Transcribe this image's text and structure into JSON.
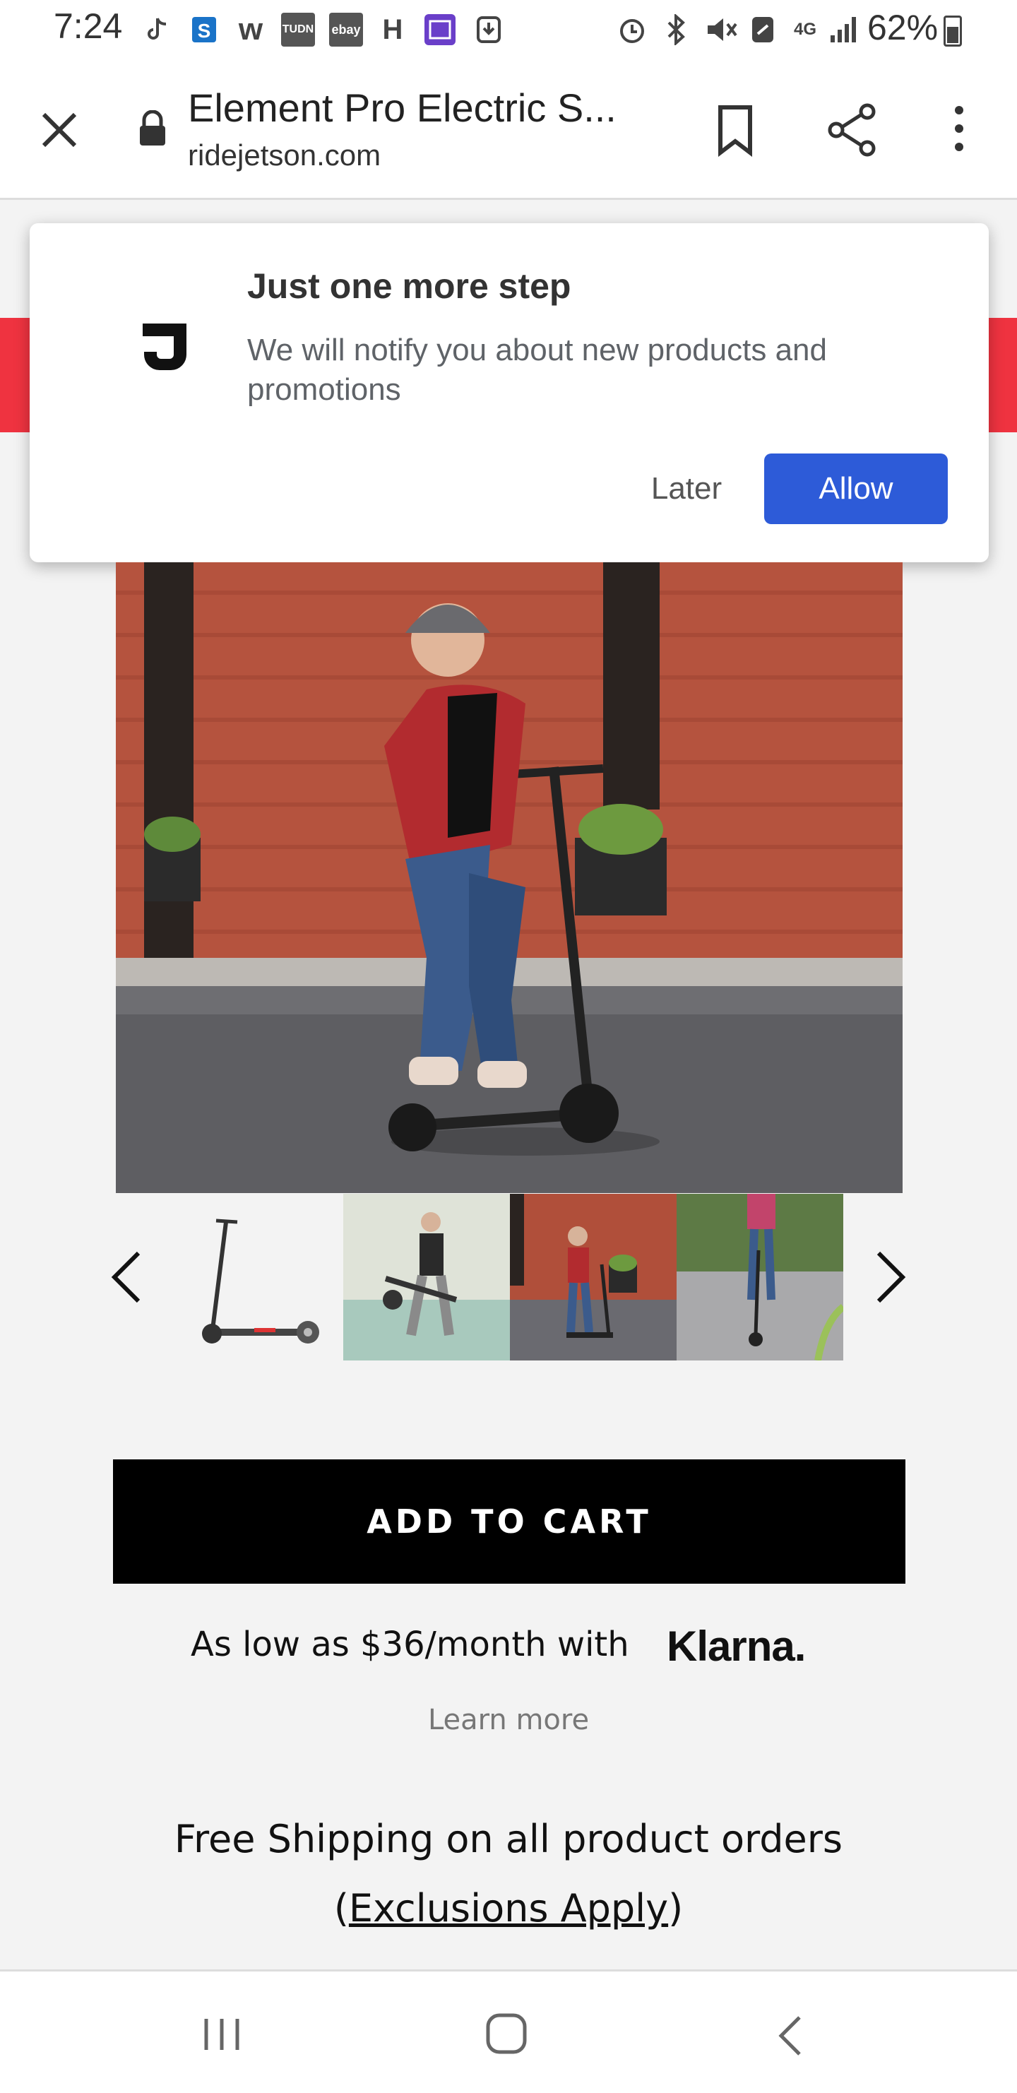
{
  "status_bar": {
    "time": "7:24",
    "battery": "62%",
    "left_icons": [
      "tiktok-icon",
      "s-app-icon",
      "w-app-icon",
      "tudn-icon",
      "ebay-icon",
      "h-app-icon",
      "calendar-app-icon",
      "download-icon"
    ],
    "right_icons": [
      "alarm-icon",
      "bluetooth-icon",
      "mute-icon",
      "nfc-icon",
      "lte-icon",
      "signal-icon",
      "battery-icon"
    ],
    "box_labels": {
      "tudn": "TUDN",
      "ebay": "ebay",
      "h": "H",
      "w": "w",
      "network": "4G"
    }
  },
  "browser": {
    "title": "Element Pro Electric S...",
    "domain": "ridejetson.com"
  },
  "popup": {
    "logo_letter": "J",
    "title": "Just one more step",
    "body": "We will notify you about new products and promotions",
    "later_label": "Later",
    "allow_label": "Allow",
    "allow_color": "#2d5bd8"
  },
  "page": {
    "banner_color": "#ef3340",
    "add_to_cart_label": "ADD TO CART",
    "klarna_text": "As low as $36/month with",
    "klarna_logo": "Klarna.",
    "learn_more": "Learn more",
    "shipping_text": "Free Shipping on all product orders",
    "exclusions_open": "(",
    "exclusions_link": "Exclusions Apply",
    "exclusions_close": ")"
  }
}
